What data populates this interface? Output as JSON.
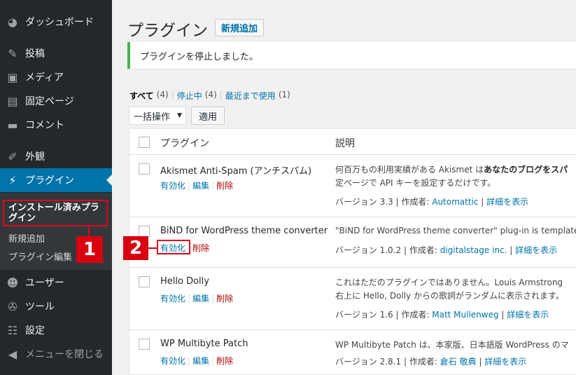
{
  "sidebar": {
    "items": [
      {
        "label": "ダッシュボード",
        "icon": "dashboard-icon"
      },
      {
        "label": "投稿",
        "icon": "pin-icon"
      },
      {
        "label": "メディア",
        "icon": "media-icon"
      },
      {
        "label": "固定ページ",
        "icon": "page-icon"
      },
      {
        "label": "コメント",
        "icon": "comment-icon"
      },
      {
        "label": "外観",
        "icon": "brush-icon"
      },
      {
        "label": "プラグイン",
        "icon": "plugin-icon"
      },
      {
        "label": "ユーザー",
        "icon": "user-icon"
      },
      {
        "label": "ツール",
        "icon": "wrench-icon"
      },
      {
        "label": "設定",
        "icon": "settings-icon"
      },
      {
        "label": "メニューを閉じる",
        "icon": "collapse-icon"
      }
    ],
    "submenu": [
      "インストール済みプラグイン",
      "新規追加",
      "プラグイン編集"
    ],
    "callout_1": "1",
    "callout_2": "2"
  },
  "header": {
    "title": "プラグイン",
    "add_new": "新規追加"
  },
  "notice": {
    "text": "プラグインを停止しました。"
  },
  "filters": {
    "all": "すべて",
    "all_count": "(4)",
    "inactive": "停止中",
    "inactive_count": "(4)",
    "recent": "最近まで使用",
    "recent_count": "(1)",
    "sep": "|"
  },
  "bulk": {
    "select": "一括操作",
    "apply": "適用"
  },
  "table": {
    "col_plugin": "プラグイン",
    "col_desc": "説明",
    "labels": {
      "activate": "有効化",
      "edit": "編集",
      "delete": "削除",
      "version": "バージョン",
      "author": "作成者",
      "details": "詳細を表示"
    },
    "rows": [
      {
        "name": "Akismet Anti-Spam (アンチスパム)",
        "desc1_pre": "何百万もの利用実績がある Akismet は",
        "desc1_bold": "あなたのブログをスパ",
        "desc2": "定ページで API キーを設定するだけです。",
        "version": "3.3",
        "author": "Automattic"
      },
      {
        "name": "BiND for WordPress theme converter",
        "desc1_pre": "\"BiND for WordPress theme converter\" plug-in is template c",
        "desc1_bold": "",
        "desc2": "",
        "version": "1.0.2",
        "author": "digitalstage inc."
      },
      {
        "name": "Hello Dolly",
        "desc1_pre": "これはただのプラグインではありません。Louis Armstrong",
        "desc1_bold": "",
        "desc2": "右上に Hello, Dolly からの歌詞がランダムに表示されます。",
        "version": "1.6",
        "author": "Matt Mullenweg"
      },
      {
        "name": "WP Multibyte Patch",
        "desc1_pre": "WP Multibyte Patch は、本家版、日本語版 WordPress のマ",
        "desc1_bold": "",
        "desc2": "",
        "version": "2.8.1",
        "author": "倉石 敬典"
      }
    ]
  },
  "colors": {
    "sidebar": "#23282d",
    "accent": "#0073aa",
    "callout": "#e0001b",
    "notice": "#46b450"
  }
}
